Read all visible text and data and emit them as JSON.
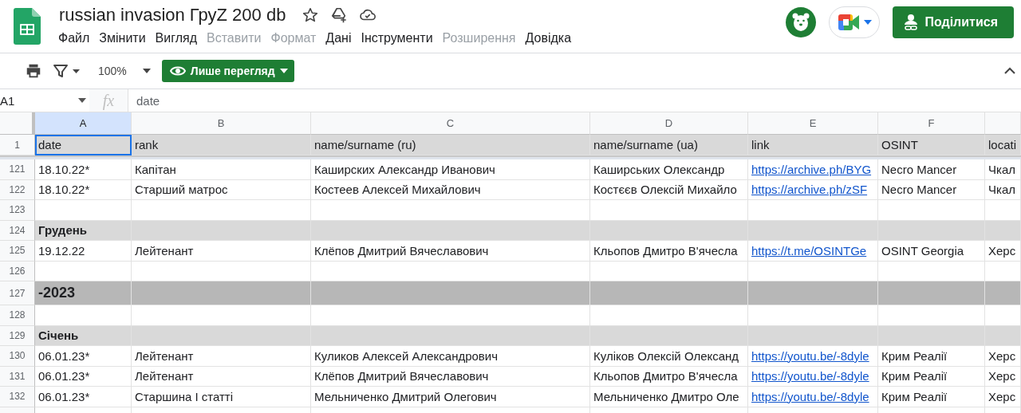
{
  "document": {
    "title": "russian invasion ГруZ 200 db"
  },
  "menu": [
    {
      "label": "Файл",
      "disabled": false
    },
    {
      "label": "Змінити",
      "disabled": false
    },
    {
      "label": "Вигляд",
      "disabled": false
    },
    {
      "label": "Вставити",
      "disabled": true
    },
    {
      "label": "Формат",
      "disabled": true
    },
    {
      "label": "Дані",
      "disabled": false
    },
    {
      "label": "Інструменти",
      "disabled": false
    },
    {
      "label": "Розширення",
      "disabled": true
    },
    {
      "label": "Довідка",
      "disabled": false
    }
  ],
  "share_button": {
    "label": "Поділитися"
  },
  "toolbar": {
    "zoom": "100%",
    "mode_button": "Лише перегляд"
  },
  "formula_bar": {
    "cell_ref": "A1",
    "fx": "fx",
    "value": "date"
  },
  "columns": [
    {
      "letter": "A",
      "selected": true
    },
    {
      "letter": "B",
      "selected": false
    },
    {
      "letter": "C",
      "selected": false
    },
    {
      "letter": "D",
      "selected": false
    },
    {
      "letter": "E",
      "selected": false
    },
    {
      "letter": "F",
      "selected": false
    },
    {
      "selected": false
    }
  ],
  "rows": [
    {
      "number": "1",
      "kind": "header",
      "cells": [
        "date",
        "rank",
        "name/surname (ru)",
        "name/surname (ua)",
        "link",
        "OSINT",
        "locati"
      ]
    },
    {
      "number": "121",
      "kind": "data",
      "cells": [
        "18.10.22*",
        "Капітан",
        "Каширских Александр Иванович",
        "Каширських Олександр",
        "https://archive.ph/BYG",
        "Necro Mancer",
        "Чкал"
      ]
    },
    {
      "number": "122",
      "kind": "data",
      "cells": [
        "18.10.22*",
        "Старший матрос",
        "Костеев Алексей Михайлович",
        "Костєєв Олексій Михайло",
        "https://archive.ph/zSF",
        "Necro Mancer",
        "Чкал"
      ]
    },
    {
      "number": "123",
      "kind": "empty",
      "cells": []
    },
    {
      "number": "124",
      "kind": "month",
      "cells": [
        "Грудень"
      ]
    },
    {
      "number": "125",
      "kind": "data",
      "cells": [
        "19.12.22",
        "Лейтенант",
        "Клёпов Дмитрий Вячеславович",
        "Кльопов Дмитро В'ячесла",
        "https://t.me/OSINTGe",
        "OSINT Georgia",
        "Херс"
      ]
    },
    {
      "number": "126",
      "kind": "empty",
      "cells": []
    },
    {
      "number": "127",
      "kind": "year",
      "cells": [
        "-2023"
      ]
    },
    {
      "number": "128",
      "kind": "empty",
      "cells": []
    },
    {
      "number": "129",
      "kind": "month",
      "cells": [
        "Січень"
      ]
    },
    {
      "number": "130",
      "kind": "data",
      "cells": [
        "06.01.23*",
        "Лейтенант",
        "Куликов Алексей Александрович",
        "Куліков Олексій Олександ",
        "https://youtu.be/-8dyle",
        "Крим Реалії",
        "Херс"
      ]
    },
    {
      "number": "131",
      "kind": "data",
      "cells": [
        "06.01.23*",
        "Лейтенант",
        "Клёпов Дмитрий Вячеславович",
        "Кльопов Дмитро В'ячесла",
        "https://youtu.be/-8dyle",
        "Крим Реалії",
        "Херс"
      ]
    },
    {
      "number": "132",
      "kind": "data",
      "cells": [
        "06.01.23*",
        "Старшина І статті",
        "Мельниченко Дмитрий Олегович",
        "Мельниченко Дмитро Оле",
        "https://youtu.be/-8dyle",
        "Крим Реалії",
        "Херс"
      ]
    }
  ]
}
